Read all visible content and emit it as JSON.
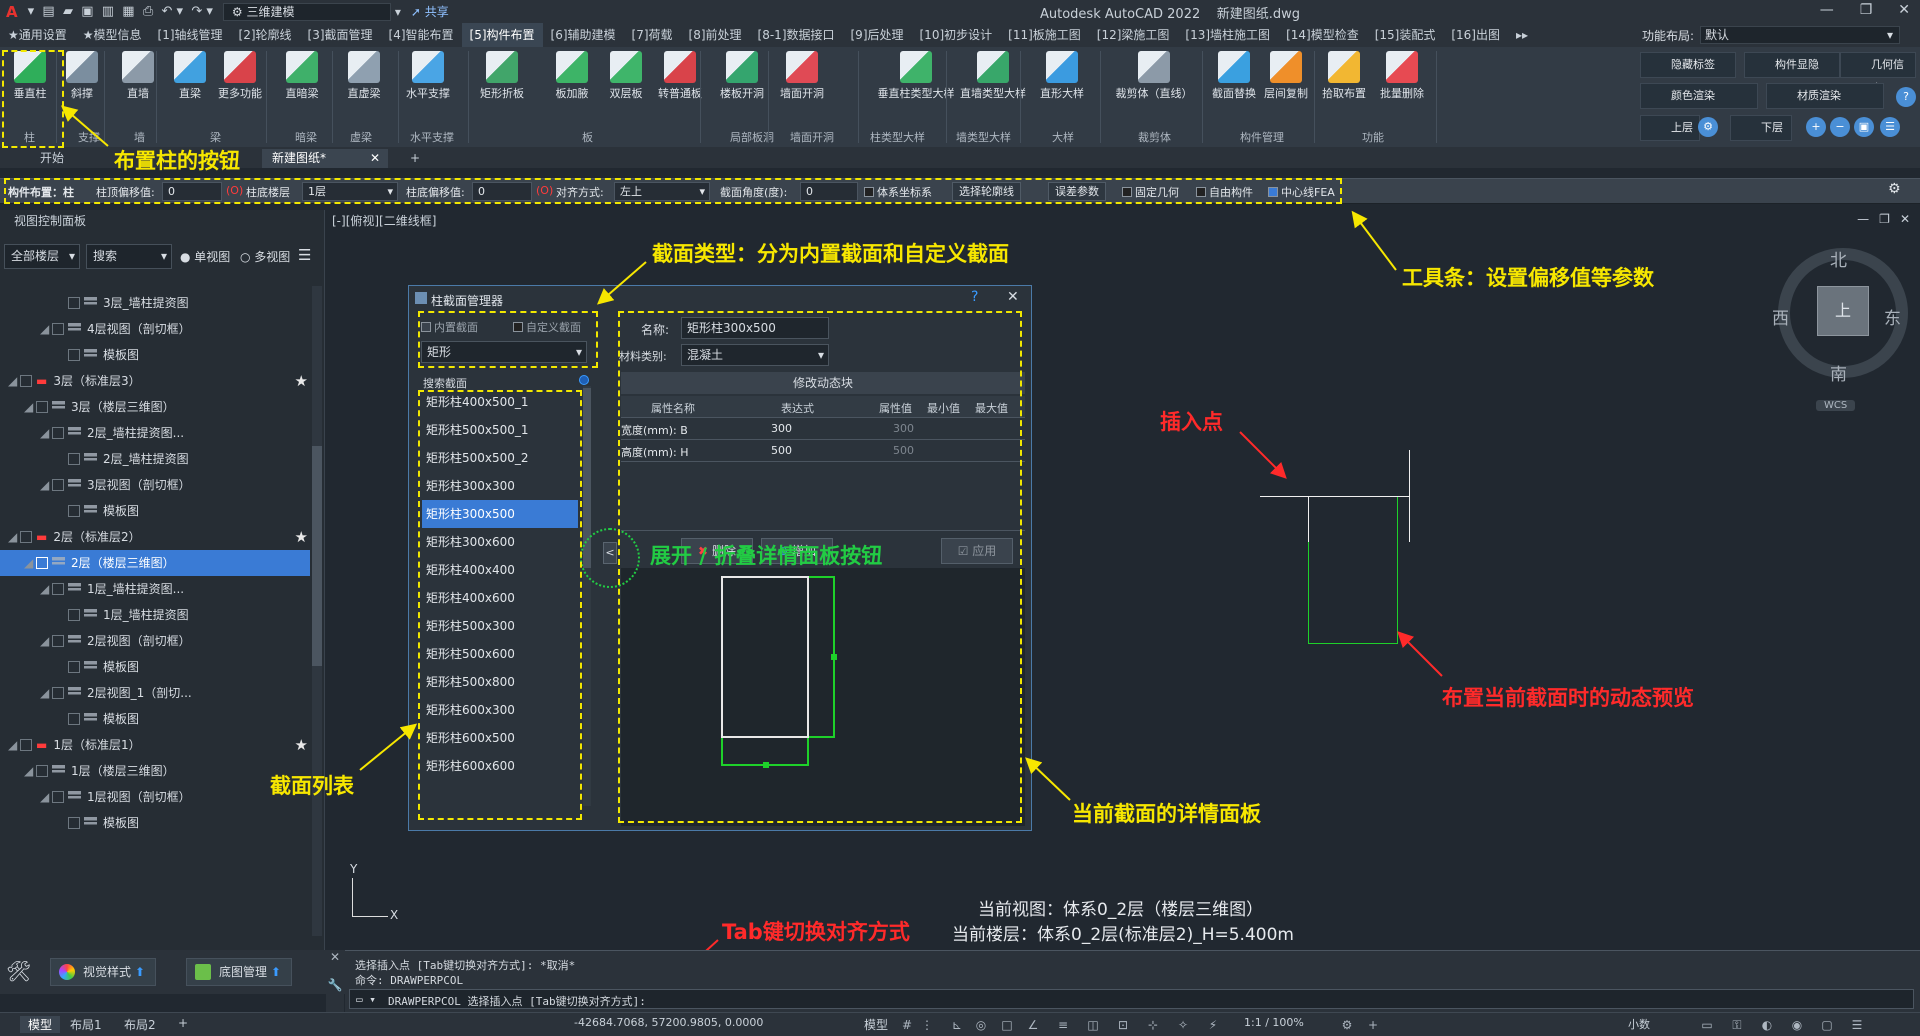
{
  "app": {
    "title": "Autodesk AutoCAD 2022",
    "file": "新建图纸.dwg",
    "workspace": "三维建模",
    "share": "共享",
    "logo": "A"
  },
  "menu": {
    "items": [
      "★通用设置",
      "★模型信息",
      "[1]轴线管理",
      "[2]轮廓线",
      "[3]截面管理",
      "[4]智能布置",
      "[5]构件布置",
      "[6]辅助建模",
      "[7]荷载",
      "[8]前处理",
      "[8-1]数据接口",
      "[9]后处理",
      "[10]初步设计",
      "[11]板施工图",
      "[12]梁施工图",
      "[13]墙柱施工图",
      "[14]模型检查",
      "[15]装配式",
      "[16]出图",
      "▸▸"
    ],
    "active_index": 6,
    "layout_label": "功能布局:",
    "layout_value": "默认"
  },
  "ribbon": {
    "buttons": [
      "垂直柱",
      "斜撑",
      "直墙",
      "直梁",
      "更多功能",
      "直暗梁",
      "直虚梁",
      "水平支撑",
      "矩形折板",
      "板加腋",
      "双层板",
      "转普通板",
      "楼板开洞",
      "墙面开洞",
      "垂直柱类型大样",
      "直墙类型大样",
      "直形大样",
      "裁剪体（直线）",
      "截面替换",
      "层间复制",
      "拾取布置",
      "批量删除"
    ],
    "groups": [
      "柱",
      "支撑",
      "墙",
      "梁",
      "暗梁",
      "虚梁",
      "水平支撑",
      "板",
      "局部板洞",
      "墙面开洞",
      "柱类型大样",
      "墙类型大样",
      "大样",
      "裁剪体",
      "构件管理",
      "功能"
    ],
    "right_buttons": [
      "隐藏标签",
      "构件显隐",
      "几何信息",
      "颜色渲染",
      "材质渲染",
      "上层",
      "下层"
    ]
  },
  "filetabs": [
    "开始",
    "新建图纸*"
  ],
  "toolstrip": {
    "title": "构件布置：柱",
    "top_offset_label": "柱顶偏移值:",
    "top_offset_value": "0",
    "bottom_floor_label": "柱底楼层",
    "bottom_floor_value": "1层",
    "bottom_offset_label": "柱底偏移值:",
    "bottom_offset_value": "0",
    "align_label": "对齐方式:",
    "align_value": "左上",
    "angle_label": "截面角度(度):",
    "angle_value": "0",
    "sys_coord": "体系坐标系",
    "pick_contour": "选择轮廓线",
    "error_params": "误差参数",
    "fixed_geom": "固定几何",
    "free_comp": "自由构件",
    "center_fea": "中心线FEA",
    "o_marker": "(O)"
  },
  "leftpanel": {
    "title": "视图控制面板",
    "floor_filter": "全部楼层",
    "search": "搜索",
    "single_view": "单视图",
    "multi_view": "多视图",
    "tree": [
      {
        "indent": 3,
        "text": "3层_墙柱提资图",
        "type": "child"
      },
      {
        "indent": 2,
        "text": "4层视图（剖切框）",
        "type": "node"
      },
      {
        "indent": 3,
        "text": "模板图",
        "type": "child"
      },
      {
        "indent": 0,
        "text": "3层（标准层3）",
        "type": "floor"
      },
      {
        "indent": 1,
        "text": "3层（楼层三维图）",
        "type": "node"
      },
      {
        "indent": 2,
        "text": "2层_墙柱提资图...",
        "type": "node"
      },
      {
        "indent": 3,
        "text": "2层_墙柱提资图",
        "type": "child"
      },
      {
        "indent": 2,
        "text": "3层视图（剖切框）",
        "type": "node"
      },
      {
        "indent": 3,
        "text": "模板图",
        "type": "child"
      },
      {
        "indent": 0,
        "text": "2层（标准层2）",
        "type": "floor"
      },
      {
        "indent": 1,
        "text": "2层（楼层三维图）",
        "type": "selected"
      },
      {
        "indent": 2,
        "text": "1层_墙柱提资图...",
        "type": "node"
      },
      {
        "indent": 3,
        "text": "1层_墙柱提资图",
        "type": "child"
      },
      {
        "indent": 2,
        "text": "2层视图（剖切框）",
        "type": "node"
      },
      {
        "indent": 3,
        "text": "模板图",
        "type": "child"
      },
      {
        "indent": 2,
        "text": "2层视图_1（剖切...",
        "type": "node"
      },
      {
        "indent": 3,
        "text": "模板图",
        "type": "child"
      },
      {
        "indent": 0,
        "text": "1层（标准层1）",
        "type": "floor"
      },
      {
        "indent": 1,
        "text": "1层（楼层三维图）",
        "type": "node"
      },
      {
        "indent": 2,
        "text": "1层视图（剖切框）",
        "type": "node"
      },
      {
        "indent": 3,
        "text": "模板图",
        "type": "child"
      }
    ],
    "bottom_buttons": [
      "视觉样式",
      "底图管理"
    ]
  },
  "canvas": {
    "view_label": "[-][俯视][二维线框]",
    "compass": {
      "n": "北",
      "s": "南",
      "e": "东",
      "w": "西",
      "center": "上",
      "wcs": "WCS"
    },
    "current_view": "当前视图：体系0_2层（楼层三维图）",
    "current_floor": "当前楼层：体系0_2层(标准层2)_H=5.400m"
  },
  "dialog": {
    "title": "柱截面管理器",
    "help": "?",
    "close": "✕",
    "builtin": "内置截面",
    "custom": "自定义截面",
    "shape": "矩形",
    "search_label": "搜索截面",
    "sections": [
      "矩形柱400x500_1",
      "矩形柱500x500_1",
      "矩形柱500x500_2",
      "矩形柱300x300",
      "矩形柱300x500",
      "矩形柱300x600",
      "矩形柱400x400",
      "矩形柱400x600",
      "矩形柱500x300",
      "矩形柱500x600",
      "矩形柱500x800",
      "矩形柱600x300",
      "矩形柱600x500",
      "矩形柱600x600"
    ],
    "selected_index": 4,
    "name_label": "名称:",
    "name_value": "矩形柱300x500",
    "material_label": "材料类别:",
    "material_value": "混凝土",
    "modify_block": "修改动态块",
    "table_headers": [
      "属性名称",
      "表达式",
      "属性值",
      "最小值",
      "最大值"
    ],
    "rows": [
      {
        "name": "宽度(mm): B",
        "expr": "300",
        "value": "300"
      },
      {
        "name": "高度(mm): H",
        "expr": "500",
        "value": "500"
      }
    ],
    "delete": "删除",
    "add": "增加",
    "apply": "应用",
    "collapse": "<"
  },
  "annotations": {
    "place_column": "布置柱的按钮",
    "section_type": "截面类型：分为内置截面和自定义截面",
    "toolbar": "工具条：设置偏移值等参数",
    "insert_point": "插入点",
    "expand_collapse": "展开 / 折叠详情面板按钮",
    "section_list": "截面列表",
    "detail_panel": "当前截面的详情面板",
    "dynamic_preview": "布置当前截面时的动态预览",
    "tab_switch": "Tab键切换对齐方式"
  },
  "command": {
    "line1": "选择插入点 [Tab键切换对齐方式]: *取消*",
    "line2": "命令:  DRAWPERPCOL",
    "prompt": "DRAWPERPCOL 选择插入点 [Tab键切换对齐方式]:"
  },
  "status": {
    "tabs": [
      "模型",
      "布局1",
      "布局2",
      "+"
    ],
    "coords": "-42684.7068, 57200.9805, 0.0000",
    "model": "模型",
    "scale": "1:1 / 100%",
    "units": "小数"
  },
  "colors": {
    "accent": "#3a7bd5",
    "annotation_yellow": "#f7e700",
    "annotation_red": "#ff2a2a",
    "preview_green": "#1ed12a"
  }
}
